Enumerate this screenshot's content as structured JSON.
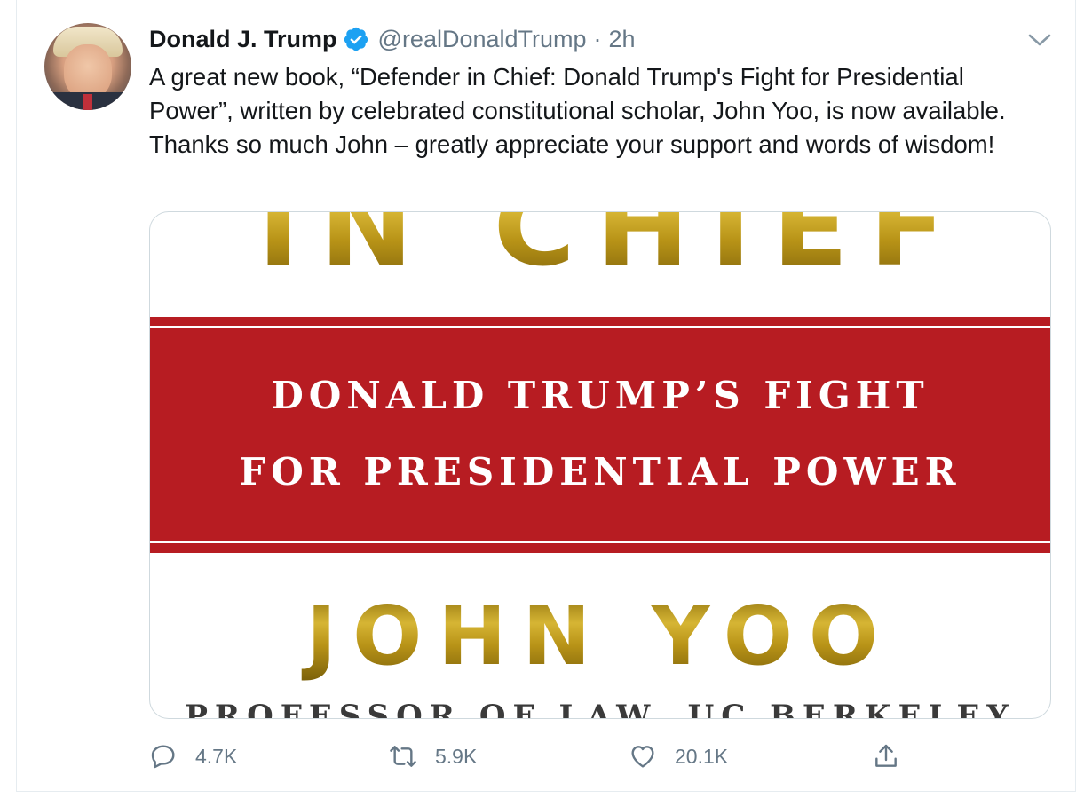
{
  "tweet": {
    "author_name": "Donald J. Trump",
    "handle": "@realDonaldTrump",
    "separator": "·",
    "time": "2h",
    "text": "A great new book, “Defender in Chief: Donald Trump's Fight for Presidential Power”, written by celebrated constitutional scholar, John Yoo, is now available. Thanks so much John – greatly appreciate your support and words of wisdom!"
  },
  "media": {
    "top_title_fragment": "IN CHIEF",
    "subtitle_line1": "DONALD TRUMP’S FIGHT",
    "subtitle_line2": "FOR PRESIDENTIAL POWER",
    "author": "JOHN YOO",
    "author_title": "PROFESSOR OF LAW, UC BERKELEY"
  },
  "actions": {
    "reply_count": "4.7K",
    "retweet_count": "5.9K",
    "like_count": "20.1K"
  },
  "icons": {
    "verified": "verified-badge-icon",
    "more": "chevron-down-icon",
    "reply": "reply-icon",
    "retweet": "retweet-icon",
    "like": "heart-icon",
    "share": "share-icon"
  },
  "colors": {
    "verified_blue": "#1da1f2",
    "secondary_text": "#657786",
    "cover_red": "#b71c22",
    "cover_gold": "#c9a61c"
  }
}
